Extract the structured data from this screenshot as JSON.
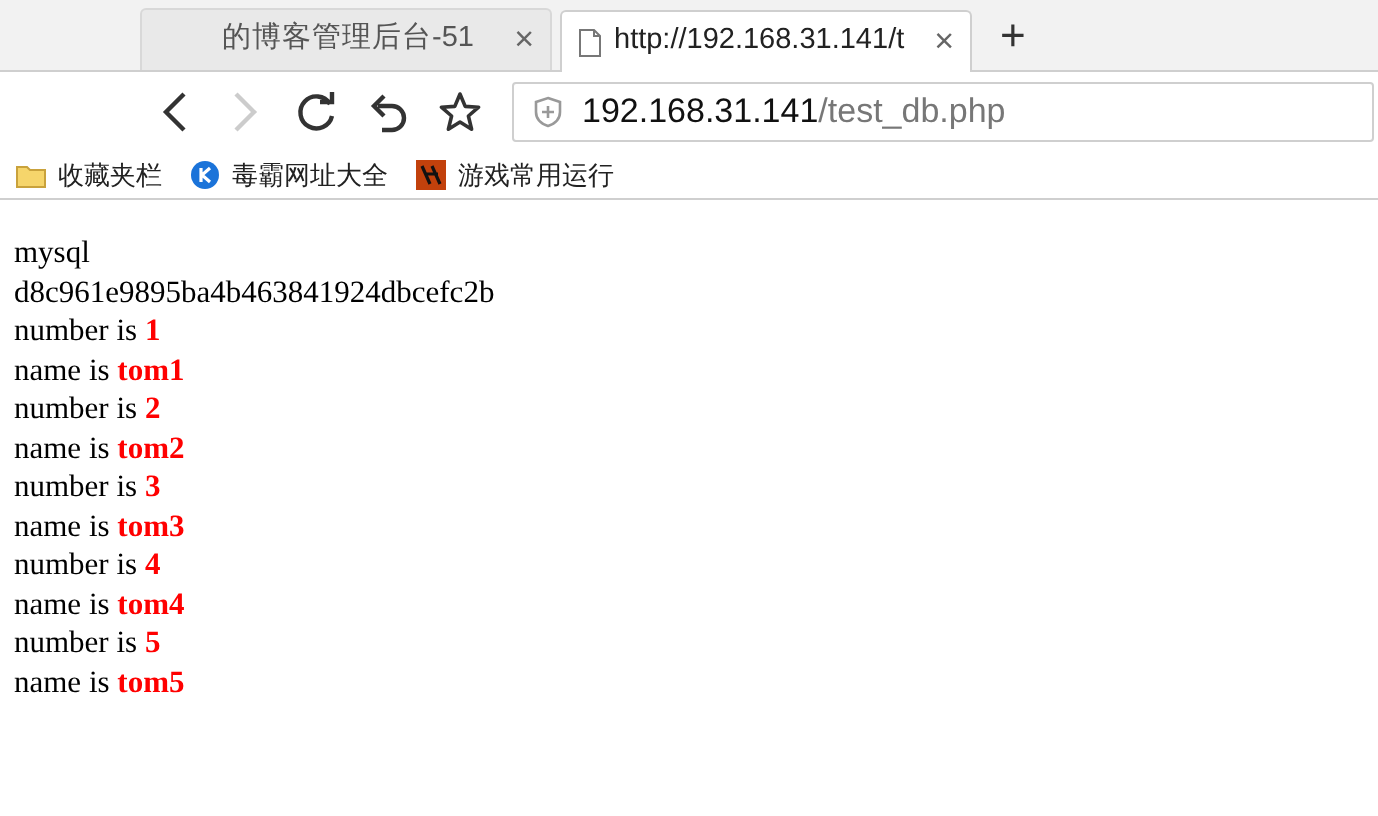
{
  "tabs": [
    {
      "title": "的博客管理后台-51",
      "selected": false,
      "close": "×"
    },
    {
      "title": "http://192.168.31.141/t",
      "selected": true,
      "close": "×"
    }
  ],
  "new_tab": "+",
  "address": {
    "host": "192.168.31.141",
    "path": "/test_db.php"
  },
  "bookmarks": [
    {
      "kind": "folder",
      "label": "收藏夹栏"
    },
    {
      "kind": "k",
      "label": "毒霸网址大全"
    },
    {
      "kind": "game",
      "label": "游戏常用运行"
    }
  ],
  "content": [
    "mysql",
    "d8c961e9895ba4b463841924dbcefc2b",
    "number is **1**",
    "name is **tom1**",
    "number is **2**",
    "name is **tom2**",
    "number is **3**",
    "name is **tom3**",
    "number is **4**",
    "name is **tom4**",
    "number is **5**",
    "name is **tom5**"
  ]
}
